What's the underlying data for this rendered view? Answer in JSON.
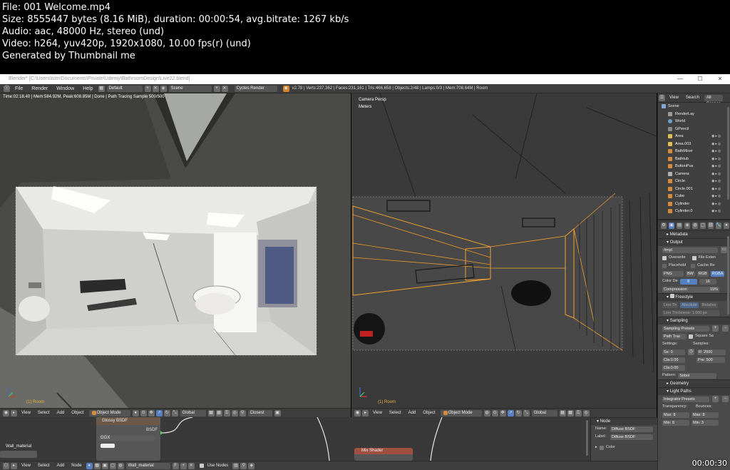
{
  "meta_lines": [
    "File: 001 Welcome.mp4",
    "Size: 8555447 bytes (8.16 MiB), duration: 00:00:54, avg.bitrate: 1267 kb/s",
    "Audio: aac, 48000 Hz, stereo (und)",
    "Video: h264, yuv420p, 1920x1080, 10.00 fps(r) (und)",
    "Generated by Thumbnail me"
  ],
  "window": {
    "title": "Blender* [C:\\Users\\tom\\Documents\\Private\\Udemy\\BathroomDesign\\Live22.blend]",
    "minimize": "—",
    "maximize": "☐",
    "close": "✕"
  },
  "menubar": {
    "items": [
      "File",
      "Render",
      "Window",
      "Help"
    ],
    "layout": "Default",
    "scene": "Scene",
    "engine": "Cycles Render",
    "stats": "v2.78 | Verts:237,362 | Faces:231,161 | Tris:466,658 | Objects:2/48 | Lamps:0/3 | Mem:708.64M | Room"
  },
  "left_viewport": {
    "status": "Time:02:18.40 | Mem:584.92M, Peak:608.85M | Done | Path Tracing Sample 500/500",
    "object_label": "(1) Room"
  },
  "right_viewport": {
    "view_name": "Camera Persp",
    "units": "Meters",
    "object_label": "(1) Room"
  },
  "outliner": {
    "tabs": [
      "View",
      "Search",
      "All Scenes"
    ],
    "scene": "Scene",
    "items": [
      "RenderLay",
      "World",
      "GPencil",
      "Area",
      "Area.003",
      "BathMixer",
      "Bathtub",
      "ButtonPus",
      "Camera",
      "Circle",
      "Circle.001",
      "Cube",
      "Cylinder",
      "Cylinder.0"
    ]
  },
  "properties": {
    "metadata": "Metadata",
    "output": "Output",
    "path": "/tmp\\",
    "overwrite": "Overwrite",
    "file_ext": "File Exten",
    "placeholders": "Placehold",
    "cache_re": "Cache Re",
    "format": "PNG",
    "bw": "BW",
    "rgb": "RGB",
    "rgba": "RGBA",
    "color_depth_label": "Color De",
    "depth_8": "8",
    "depth_16": "16",
    "compression": "Compression:",
    "compression_val": "15%",
    "freestyle": "Freestyle",
    "fs_line": "Line Thickness: 1.000 px",
    "fs_abs": "Absolute",
    "fs_rel": "Relative",
    "fs_mode": "Line Th",
    "sampling": "Sampling",
    "presets": "Sampling Presets",
    "integrator": "Path Trac",
    "square": "Square Sa",
    "settings": "Settings:",
    "samples": "Samples:",
    "seed": "Se: 0",
    "clamp_d": "Cla:0.00",
    "clamp_i": "Cla:0.00",
    "render": "R: 2000",
    "preview": "Pre: 500",
    "pattern_label": "Pattern:",
    "pattern": "Sobol",
    "geometry": "Geometry",
    "light_paths": "Light Paths",
    "integrator_presets": "Integrator Presets",
    "transparency": "Transparency:",
    "bounces": "Bounces:",
    "max_t": "Max: 8",
    "min_t": "Min: 8",
    "max_b": "Max: 8",
    "min_b": "Min: 3"
  },
  "view_header": {
    "items": [
      "View",
      "Select",
      "Add",
      "Object"
    ],
    "mode": "Object Mode",
    "orientation": "Global",
    "snap": "Closest"
  },
  "node_editor": {
    "material": "Wall_material",
    "node_title": "Glossy BSDF",
    "node_output": "BSDF",
    "distribution": "GGX",
    "mix_shader": "Mix Shader",
    "panel_title": "Node",
    "name_label": "Name:",
    "name_val": "Diffuse BSDF",
    "label_label": "Label:",
    "label_val": "Diffuse BSDF",
    "color_section": "Color",
    "header_items": [
      "View",
      "Select",
      "Add",
      "Node"
    ],
    "material_field": "Wall_material",
    "use_nodes": "Use Nodes"
  },
  "timecode": "00:00:30"
}
